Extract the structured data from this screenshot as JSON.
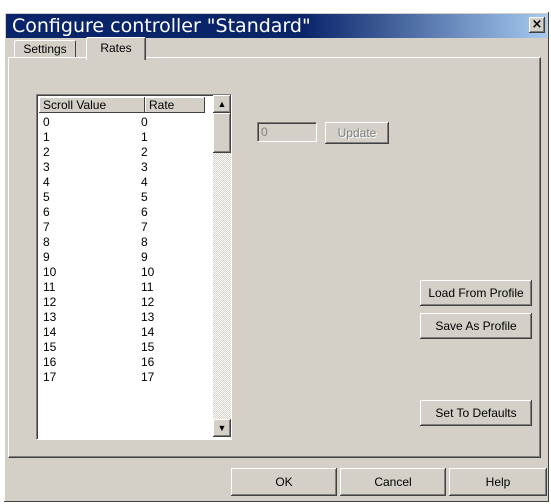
{
  "window": {
    "title": "Configure controller \"Standard\"",
    "close_label": "×"
  },
  "tabs": [
    {
      "label": "Settings"
    },
    {
      "label": "Rates"
    }
  ],
  "list": {
    "headers": [
      "Scroll Value",
      "Rate"
    ],
    "rows": [
      [
        "0",
        "0"
      ],
      [
        "1",
        "1"
      ],
      [
        "2",
        "2"
      ],
      [
        "3",
        "3"
      ],
      [
        "4",
        "4"
      ],
      [
        "5",
        "5"
      ],
      [
        "6",
        "6"
      ],
      [
        "7",
        "7"
      ],
      [
        "8",
        "8"
      ],
      [
        "9",
        "9"
      ],
      [
        "10",
        "10"
      ],
      [
        "11",
        "11"
      ],
      [
        "12",
        "12"
      ],
      [
        "13",
        "13"
      ],
      [
        "14",
        "14"
      ],
      [
        "15",
        "15"
      ],
      [
        "16",
        "16"
      ],
      [
        "17",
        "17"
      ]
    ],
    "scroll_up_icon": "arrow-up-icon",
    "scroll_down_icon": "arrow-down-icon"
  },
  "editor": {
    "value": "0",
    "update_label": "Update"
  },
  "buttons": {
    "load_label": "Load From Profile",
    "save_label": "Save As Profile",
    "defaults_label": "Set To Defaults",
    "ok_label": "OK",
    "cancel_label": "Cancel",
    "help_label": "Help"
  }
}
